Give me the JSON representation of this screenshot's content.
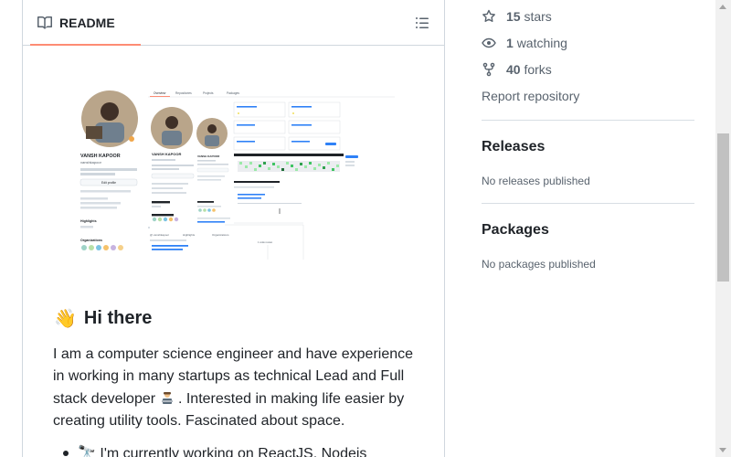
{
  "readme": {
    "tab_label": "README",
    "outline_icon": "list-unordered-icon",
    "book_icon": "book-icon",
    "heading": "Hi there",
    "heading_emoji": "👋",
    "bio_line1": "I am a computer science engineer and have experience",
    "bio_line2": "in working in many startups as technical Lead and Full",
    "bio_line3a": "stack developer",
    "bio_line3b": ". Interested in making life easier by",
    "bio_line4": "creating utility tools. Fascinated about space.",
    "bullet_text": "🔭 I'm currently working on ReactJS, Nodejs"
  },
  "preview": {
    "name": "VANSH KAPOOR",
    "username": "vanshkapoor",
    "bio": "React | javascript | ML | python | startup enthusiast",
    "edit_button": "Edit profile",
    "highlights": "Highlights",
    "organizations": "Organizations",
    "tabs": [
      "Overview",
      "Repositories",
      "Projects",
      "Packages"
    ]
  },
  "sidebar": {
    "stars_count": "15",
    "stars_label": "stars",
    "watching_count": "1",
    "watching_label": "watching",
    "forks_count": "40",
    "forks_label": "forks",
    "report": "Report repository",
    "releases_title": "Releases",
    "releases_note": "No releases published",
    "packages_title": "Packages",
    "packages_note": "No packages published"
  },
  "colors": {
    "tab_underline": "#fd8c73",
    "muted_text": "#59636e",
    "border": "#d0d7de"
  }
}
